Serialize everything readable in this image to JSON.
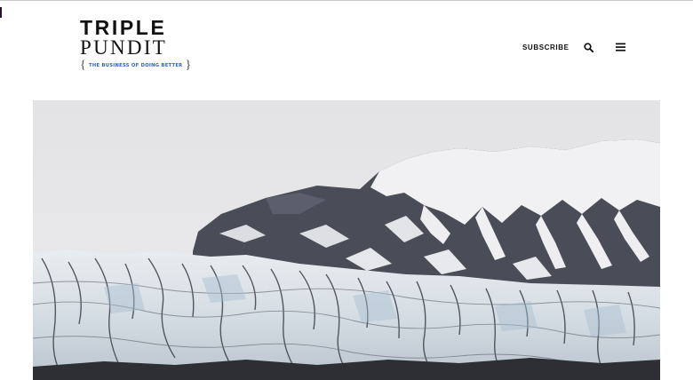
{
  "header": {
    "logo": {
      "line1": "TRIPLE",
      "line2": "PUNDIT",
      "tagline": "THE BUSINESS OF DOING BETTER",
      "tag_open": "{",
      "tag_close": "}"
    },
    "nav": {
      "subscribe_label": "SUBSCRIBE",
      "search_icon": "search-icon",
      "menu_icon": "hamburger-menu-icon"
    }
  },
  "hero": {
    "image_description": "glacier-and-snowy-mountain-photo"
  },
  "colors": {
    "text": "#111111",
    "tagline": "#2b62c8",
    "sky": "#e6e6e8"
  }
}
